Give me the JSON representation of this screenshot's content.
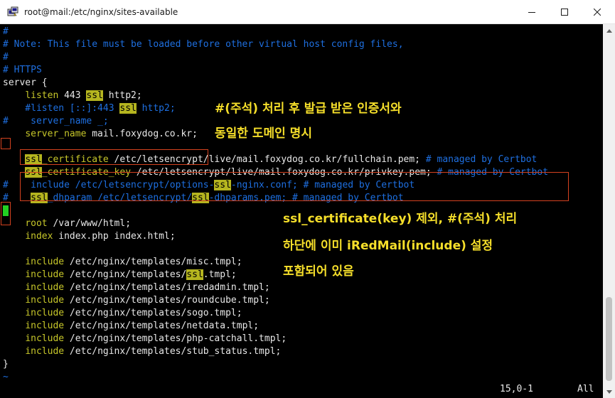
{
  "window": {
    "title": "root@mail:/etc/nginx/sites-available",
    "icon": "putty-terminal-icon"
  },
  "editor": {
    "lines": [
      {
        "parts": [
          {
            "t": "#",
            "c": "cmt"
          }
        ]
      },
      {
        "parts": [
          {
            "t": "# Note: This file must be loaded before other virtual host config files,",
            "c": "cmt"
          }
        ]
      },
      {
        "parts": [
          {
            "t": "#",
            "c": "cmt"
          }
        ]
      },
      {
        "parts": [
          {
            "t": "# HTTPS",
            "c": "cmt"
          }
        ]
      },
      {
        "parts": [
          {
            "t": "server {",
            "c": ""
          }
        ]
      },
      {
        "parts": [
          {
            "t": "    ",
            "c": ""
          },
          {
            "t": "listen",
            "c": "kw"
          },
          {
            "t": " 443 ",
            "c": ""
          },
          {
            "t": "ssl",
            "c": "hl"
          },
          {
            "t": " http2;",
            "c": ""
          }
        ]
      },
      {
        "parts": [
          {
            "t": "    #listen [::]:443 ",
            "c": "cmt"
          },
          {
            "t": "ssl",
            "c": "hl"
          },
          {
            "t": " http2;",
            "c": "cmt"
          }
        ]
      },
      {
        "parts": [
          {
            "t": "#",
            "c": "cmt"
          },
          {
            "t": "    server_name _;",
            "c": "cmt"
          }
        ]
      },
      {
        "parts": [
          {
            "t": "    ",
            "c": ""
          },
          {
            "t": "server_name",
            "c": "kw"
          },
          {
            "t": " mail.foxydog.co.kr;",
            "c": ""
          }
        ]
      },
      {
        "parts": [
          {
            "t": "",
            "c": ""
          }
        ]
      },
      {
        "parts": [
          {
            "t": "    ",
            "c": ""
          },
          {
            "t": "ssl",
            "c": "hl"
          },
          {
            "t": "_certificate",
            "c": "kw"
          },
          {
            "t": " /etc/letsencrypt/live/mail.foxydog.co.kr/fullchain.pem; ",
            "c": ""
          },
          {
            "t": "# managed by Certbot",
            "c": "cmt"
          }
        ]
      },
      {
        "parts": [
          {
            "t": "    ",
            "c": ""
          },
          {
            "t": "ssl",
            "c": "hl"
          },
          {
            "t": "_certificate_key",
            "c": "kw"
          },
          {
            "t": " /etc/letsencrypt/live/mail.foxydog.co.kr/privkey.pem; ",
            "c": ""
          },
          {
            "t": "# managed by Certbot",
            "c": "cmt"
          }
        ]
      },
      {
        "parts": [
          {
            "t": "#",
            "c": "cmt"
          },
          {
            "t": "    include /etc/letsencrypt/options-",
            "c": "cmt"
          },
          {
            "t": "ssl",
            "c": "hl"
          },
          {
            "t": "-nginx.conf; # managed by Certbot",
            "c": "cmt"
          }
        ]
      },
      {
        "parts": [
          {
            "t": "#",
            "c": "cmt"
          },
          {
            "t": "    ",
            "c": ""
          },
          {
            "t": "ssl",
            "c": "hl"
          },
          {
            "t": "_dhparam /etc/letsencrypt/",
            "c": "cmt"
          },
          {
            "t": "ssl",
            "c": "hl"
          },
          {
            "t": "-dhparams.pem; # managed by Certbot",
            "c": "cmt"
          }
        ]
      },
      {
        "parts": [
          {
            "t": " ",
            "c": "cur"
          }
        ]
      },
      {
        "parts": [
          {
            "t": "    ",
            "c": ""
          },
          {
            "t": "root",
            "c": "kw"
          },
          {
            "t": " /var/www/html;",
            "c": ""
          }
        ]
      },
      {
        "parts": [
          {
            "t": "    ",
            "c": ""
          },
          {
            "t": "index",
            "c": "kw"
          },
          {
            "t": " index.php index.html;",
            "c": ""
          }
        ]
      },
      {
        "parts": [
          {
            "t": "",
            "c": ""
          }
        ]
      },
      {
        "parts": [
          {
            "t": "    ",
            "c": ""
          },
          {
            "t": "include",
            "c": "kw"
          },
          {
            "t": " /etc/nginx/templates/misc.tmpl;",
            "c": ""
          }
        ]
      },
      {
        "parts": [
          {
            "t": "    ",
            "c": ""
          },
          {
            "t": "include",
            "c": "kw"
          },
          {
            "t": " /etc/nginx/templates/",
            "c": ""
          },
          {
            "t": "ssl",
            "c": "hl"
          },
          {
            "t": ".tmpl;",
            "c": ""
          }
        ]
      },
      {
        "parts": [
          {
            "t": "    ",
            "c": ""
          },
          {
            "t": "include",
            "c": "kw"
          },
          {
            "t": " /etc/nginx/templates/iredadmin.tmpl;",
            "c": ""
          }
        ]
      },
      {
        "parts": [
          {
            "t": "    ",
            "c": ""
          },
          {
            "t": "include",
            "c": "kw"
          },
          {
            "t": " /etc/nginx/templates/roundcube.tmpl;",
            "c": ""
          }
        ]
      },
      {
        "parts": [
          {
            "t": "    ",
            "c": ""
          },
          {
            "t": "include",
            "c": "kw"
          },
          {
            "t": " /etc/nginx/templates/sogo.tmpl;",
            "c": ""
          }
        ]
      },
      {
        "parts": [
          {
            "t": "    ",
            "c": ""
          },
          {
            "t": "include",
            "c": "kw"
          },
          {
            "t": " /etc/nginx/templates/netdata.tmpl;",
            "c": ""
          }
        ]
      },
      {
        "parts": [
          {
            "t": "    ",
            "c": ""
          },
          {
            "t": "include",
            "c": "kw"
          },
          {
            "t": " /etc/nginx/templates/php-catchall.tmpl;",
            "c": ""
          }
        ]
      },
      {
        "parts": [
          {
            "t": "    ",
            "c": ""
          },
          {
            "t": "include",
            "c": "kw"
          },
          {
            "t": " /etc/nginx/templates/stub_status.tmpl;",
            "c": ""
          }
        ]
      },
      {
        "parts": [
          {
            "t": "}",
            "c": ""
          }
        ]
      },
      {
        "parts": [
          {
            "t": "~",
            "c": "tilde"
          }
        ]
      }
    ]
  },
  "annotations": {
    "top_line1": "#(주석) 처리 후 발급 받은 인증서와",
    "top_line2": "동일한 도메인 명시",
    "bottom_line1": "ssl_certificate(key) 제외, #(주석) 처리",
    "bottom_line2": "하단에 이미 iRedMail(include) 설정",
    "bottom_line3": "포함되어 있음",
    "color": "#f6df2a",
    "box_color": "#d4421f"
  },
  "statusline": {
    "position": "15,0-1",
    "scroll": "All"
  }
}
